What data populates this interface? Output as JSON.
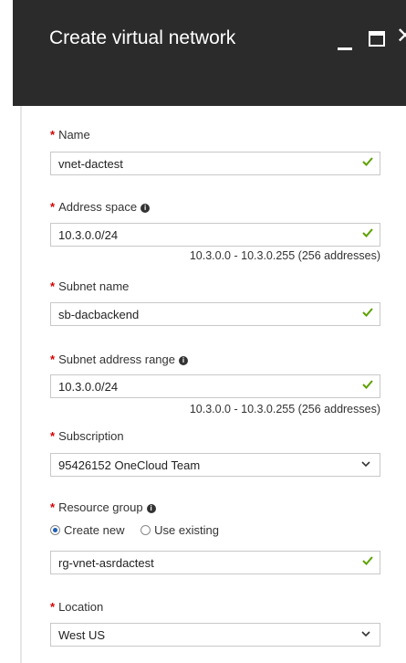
{
  "window": {
    "title": "Create virtual network",
    "minimize_icon": "minimize-icon",
    "maximize_icon": "maximize-icon",
    "close_icon": "close-icon"
  },
  "form": {
    "name": {
      "label": "Name",
      "value": "vnet-dactest",
      "status_icon": "check-icon"
    },
    "address_space": {
      "label": "Address space",
      "value": "10.3.0.0/24",
      "hint": "10.3.0.0 - 10.3.0.255 (256 addresses)",
      "status_icon": "check-icon"
    },
    "subnet_name": {
      "label": "Subnet name",
      "value": "sb-dacbackend",
      "status_icon": "check-icon"
    },
    "subnet_range": {
      "label": "Subnet address range",
      "value": "10.3.0.0/24",
      "hint": "10.3.0.0 - 10.3.0.255 (256 addresses)",
      "status_icon": "check-icon"
    },
    "subscription": {
      "label": "Subscription",
      "value": "95426152 OneCloud Team"
    },
    "resource_group": {
      "label": "Resource group",
      "options": [
        "Create new",
        "Use existing"
      ],
      "selected": "Create new",
      "value": "rg-vnet-asrdactest",
      "status_icon": "check-icon"
    },
    "location": {
      "label": "Location",
      "value": "West US"
    }
  },
  "colors": {
    "header_bg": "#2b2b2b",
    "required": "#d40000",
    "valid_check": "#5ba100"
  }
}
